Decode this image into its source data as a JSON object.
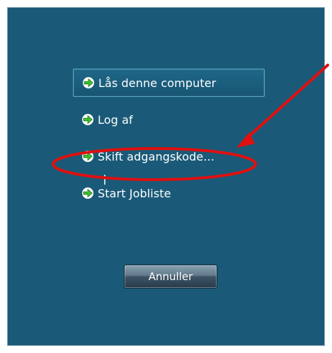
{
  "menu": {
    "items": [
      {
        "label": "Lås denne computer",
        "icon": "green-arrow-icon",
        "focused": true
      },
      {
        "label": "Log af",
        "icon": "green-arrow-icon",
        "focused": false
      },
      {
        "label": "Skift adgangskode...",
        "icon": "green-arrow-icon",
        "focused": false
      },
      {
        "label": "Start Jobliste",
        "icon": "green-arrow-icon",
        "focused": false
      }
    ]
  },
  "cancel_button": {
    "label": "Annuller"
  },
  "colors": {
    "background": "#1a5a78",
    "annotation": "#e01010",
    "arrow_icon": "#3fbf2f",
    "text": "#ffffff"
  }
}
